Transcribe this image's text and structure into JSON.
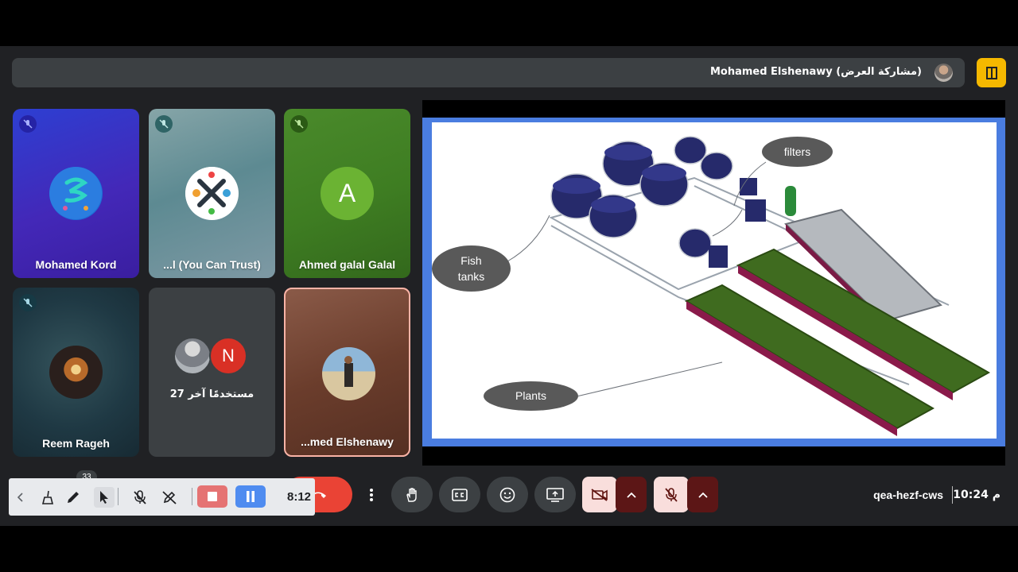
{
  "banner": {
    "presenter_text": "Mohamed Elshenawy (مشاركة العرض)"
  },
  "tiles": [
    {
      "name": "Mohamed Kord",
      "muted": true
    },
    {
      "name": "...l (You Can Trust)",
      "muted": true
    },
    {
      "name": "Ahmed galal Galal",
      "muted": true,
      "avatar_letter": "A"
    },
    {
      "name": "Reem Rageh",
      "muted": true
    },
    {
      "others_count": "27 مستخدمًا آخر",
      "others_letter": "N"
    },
    {
      "name": "...med Elshenawy",
      "muted": false
    }
  ],
  "slide": {
    "labels": {
      "filters": "filters",
      "fish_tanks_line1": "Fish",
      "fish_tanks_line2": "tanks",
      "plants": "Plants"
    }
  },
  "meeting": {
    "code": "qea-hezf-cws",
    "time": "10:24 م"
  },
  "annotation_toolbar": {
    "elapsed": "8:12",
    "badge": "33"
  },
  "colors": {
    "pin": "#f5b800",
    "end_call": "#ea4335",
    "record": "#e57373",
    "pause": "#4f8cf0",
    "slide_border": "#4a7de0",
    "plant_bed": "#3f6b1f",
    "bed_rim": "#8a1a4a",
    "tank": "#262a6b"
  }
}
